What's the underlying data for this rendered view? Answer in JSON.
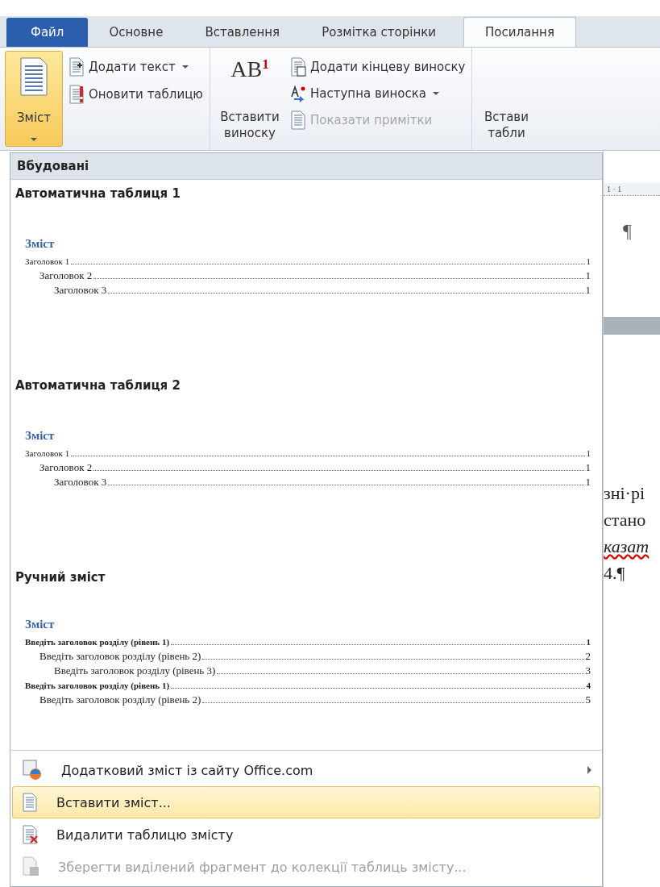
{
  "tabs": [
    {
      "label": "Файл",
      "kind": "file",
      "selected": false
    },
    {
      "label": "Основне",
      "kind": "normal",
      "selected": false
    },
    {
      "label": "Вставлення",
      "kind": "normal",
      "selected": false
    },
    {
      "label": "Розмітка сторінки",
      "kind": "normal",
      "selected": false
    },
    {
      "label": "Посилання",
      "kind": "normal",
      "selected": true
    }
  ],
  "ribbon": {
    "toc_button": {
      "label": "Зміст",
      "selected": true
    },
    "toc_small_buttons": [
      {
        "label": "Додати текст",
        "kind": "add-text",
        "dropdown": true,
        "disabled": false
      },
      {
        "label": "Оновити таблицю",
        "kind": "update",
        "dropdown": false,
        "disabled": false
      }
    ],
    "footnote_button": {
      "icon_text": "AB$^{1}$",
      "label_lines": [
        "Вставити",
        "виноску"
      ]
    },
    "footnote_small_buttons": [
      {
        "label": "Додати кінцеву виноску",
        "kind": "endnote",
        "dropdown": false,
        "disabled": false
      },
      {
        "label": "Наступна виноска",
        "kind": "next",
        "dropdown": true,
        "disabled": false
      },
      {
        "label": "Показати примітки",
        "kind": "notes",
        "dropdown": false,
        "disabled": true
      }
    ],
    "cut_button": {
      "label_lines": [
        "Встави",
        "табли"
      ]
    }
  },
  "menu": {
    "header": "Вбудовані",
    "galleries": [
      {
        "title": "Автоматична таблиця 1",
        "preview": {
          "heading": "Зміст",
          "entries": [
            {
              "text": "Заголовок 1",
              "page": "1",
              "children": [
                {
                  "text": "Заголовок 2",
                  "page": "1",
                  "children": [
                    {
                      "text": "Заголовок 3",
                      "page": "1"
                    }
                  ]
                }
              ]
            }
          ]
        }
      },
      {
        "title": "Автоматична таблиця 2",
        "preview": {
          "heading": "Зміст",
          "entries": [
            {
              "text": "Заголовок 1",
              "page": "1",
              "children": [
                {
                  "text": "Заголовок 2",
                  "page": "1",
                  "children": [
                    {
                      "text": "Заголовок 3",
                      "page": "1"
                    }
                  ]
                }
              ]
            }
          ]
        }
      },
      {
        "title": "Ручний зміст",
        "preview": {
          "heading": "Зміст",
          "entries": [
            {
              "text": "Введіть заголовок розділу (рівень 1)",
              "page": "1",
              "children": [
                {
                  "text": "Введіть заголовок розділу (рівень 2)",
                  "page": "2",
                  "children": [
                    {
                      "text": "Введіть заголовок розділу (рівень 3)",
                      "page": "3"
                    }
                  ]
                }
              ]
            },
            {
              "text": "Введіть заголовок розділу (рівень 1)",
              "page": "4",
              "children": [
                {
                  "text": "Введіть заголовок розділу (рівень 2)",
                  "page": "5"
                }
              ]
            }
          ]
        }
      }
    ],
    "items": [
      {
        "label": "Додатковий зміст із сайту Office.com",
        "kind": "web",
        "submenu": true,
        "selected": false,
        "disabled": false
      },
      {
        "label": "Вставити зміст...",
        "kind": "insert",
        "submenu": false,
        "selected": true,
        "disabled": false
      },
      {
        "label": "Видалити таблицю змісту",
        "kind": "delete",
        "submenu": false,
        "selected": false,
        "disabled": false
      },
      {
        "label": "Зберегти виділений фрагмент до колекції таблиць змісту...",
        "kind": "save",
        "submenu": false,
        "selected": false,
        "disabled": true
      }
    ]
  },
  "document": {
    "ruler": "1 · 1",
    "mark": "¶",
    "lines": [
      {
        "text": "зні·рі",
        "kind": "plain"
      },
      {
        "text": "стано",
        "kind": "plain"
      },
      {
        "text": "казат",
        "kind": "misspelled"
      },
      {
        "text": "4.¶",
        "kind": "plain"
      }
    ]
  }
}
